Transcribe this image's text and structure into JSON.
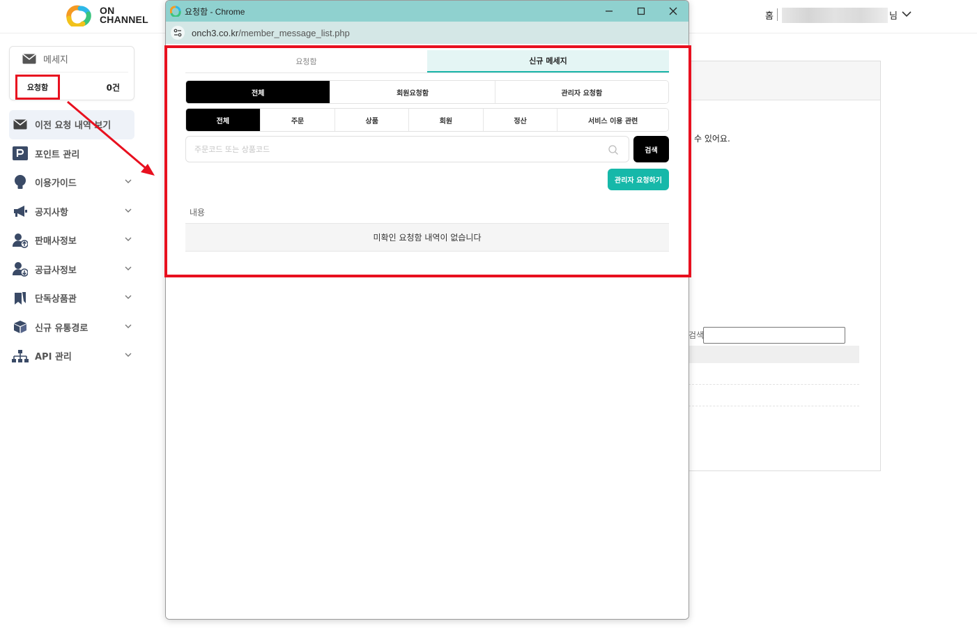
{
  "header": {
    "logo_text_line1": "ON",
    "logo_text_line2": "CHANNEL",
    "home_label": "홈",
    "user_suffix": "님"
  },
  "sidebar": {
    "message_title": "메세지",
    "request_box_label": "요청함",
    "request_count": "0건",
    "items": [
      {
        "label": "이전 요청 내역 보기",
        "icon": "envelope-icon",
        "active": true
      },
      {
        "label": "포인트 관리",
        "icon": "point-p-icon"
      },
      {
        "label": "이용가이드",
        "icon": "lightbulb-icon"
      },
      {
        "label": "공지사항",
        "icon": "megaphone-icon"
      },
      {
        "label": "판매사정보",
        "icon": "user-up-icon"
      },
      {
        "label": "공급사정보",
        "icon": "user-down-icon"
      },
      {
        "label": "단독상품관",
        "icon": "bookmark-icon"
      },
      {
        "label": "신규 유통경로",
        "icon": "box-icon"
      },
      {
        "label": "API 관리",
        "icon": "network-icon"
      }
    ]
  },
  "background_page": {
    "text_fragment": "수 있어요.",
    "search_label_fragment": "검색"
  },
  "popup": {
    "window_title": "요청함 - Chrome",
    "url_domain": "onch3.co.kr",
    "url_path": "/member_message_list.php",
    "tabs": [
      {
        "label": "요청함",
        "active": false
      },
      {
        "label": "신규 메세지",
        "active": true
      }
    ],
    "filter_type": [
      {
        "label": "전체",
        "active": true
      },
      {
        "label": "회원요청함",
        "active": false
      },
      {
        "label": "관리자 요청함",
        "active": false
      }
    ],
    "filter_category": [
      {
        "label": "전체",
        "active": true
      },
      {
        "label": "주문",
        "active": false
      },
      {
        "label": "상품",
        "active": false
      },
      {
        "label": "회원",
        "active": false
      },
      {
        "label": "정산",
        "active": false
      },
      {
        "label": "서비스 이용 관련",
        "active": false
      }
    ],
    "search": {
      "placeholder": "주문코드 또는 상품코드",
      "value": "",
      "button_label": "검색"
    },
    "admin_request_button": "관리자 요청하기",
    "table": {
      "column_header": "내용",
      "empty_message": "미확인 요청함 내역이 없습니다"
    }
  },
  "colors": {
    "accent_teal": "#16b8a9",
    "annotation_red": "#e8101f",
    "titlebar": "#8fd1cf"
  }
}
